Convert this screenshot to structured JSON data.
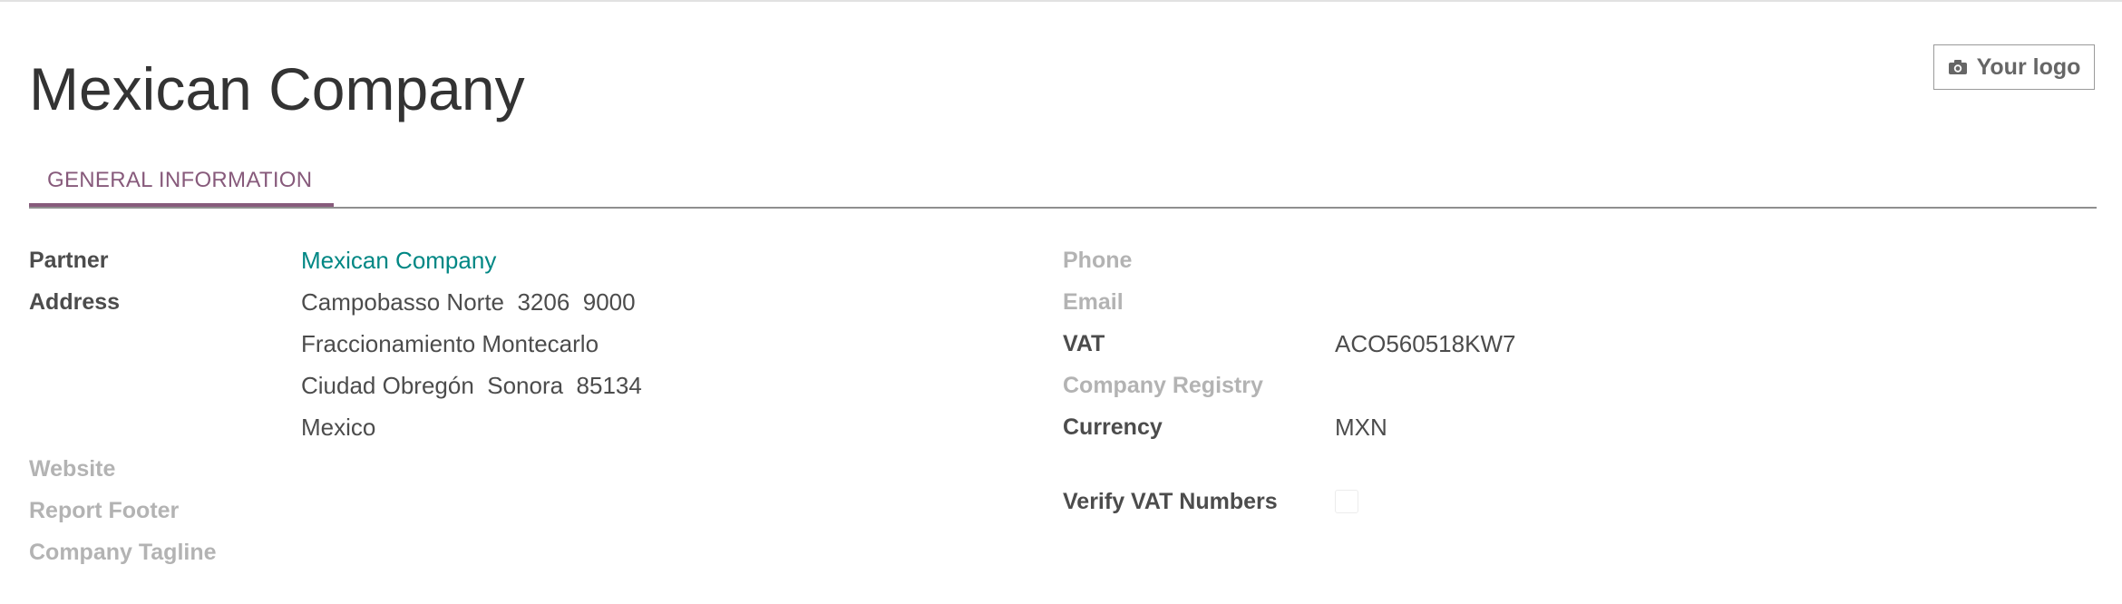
{
  "company": {
    "name": "Mexican Company"
  },
  "logo_button": {
    "label": "Your logo",
    "icon": "camera-icon"
  },
  "tabs": [
    {
      "label": "GENERAL INFORMATION",
      "active": true
    }
  ],
  "left_fields": {
    "partner": {
      "label": "Partner",
      "value": "Mexican Company"
    },
    "address": {
      "label": "Address",
      "lines": [
        "Campobasso Norte  3206  9000",
        "Fraccionamiento Montecarlo",
        "Ciudad Obregón  Sonora  85134",
        "Mexico"
      ]
    },
    "website": {
      "label": "Website"
    },
    "report_footer": {
      "label": "Report Footer"
    },
    "company_tagline": {
      "label": "Company Tagline"
    }
  },
  "right_fields": {
    "phone": {
      "label": "Phone"
    },
    "email": {
      "label": "Email"
    },
    "vat": {
      "label": "VAT",
      "value": "ACO560518KW7"
    },
    "company_registry": {
      "label": "Company Registry"
    },
    "currency": {
      "label": "Currency",
      "value": "MXN"
    },
    "verify_vat": {
      "label": "Verify VAT Numbers",
      "checked": false
    }
  },
  "colors": {
    "accent": "#875a7b",
    "link": "#008784",
    "text": "#4c4c4c",
    "muted": "#b3b3b3"
  }
}
